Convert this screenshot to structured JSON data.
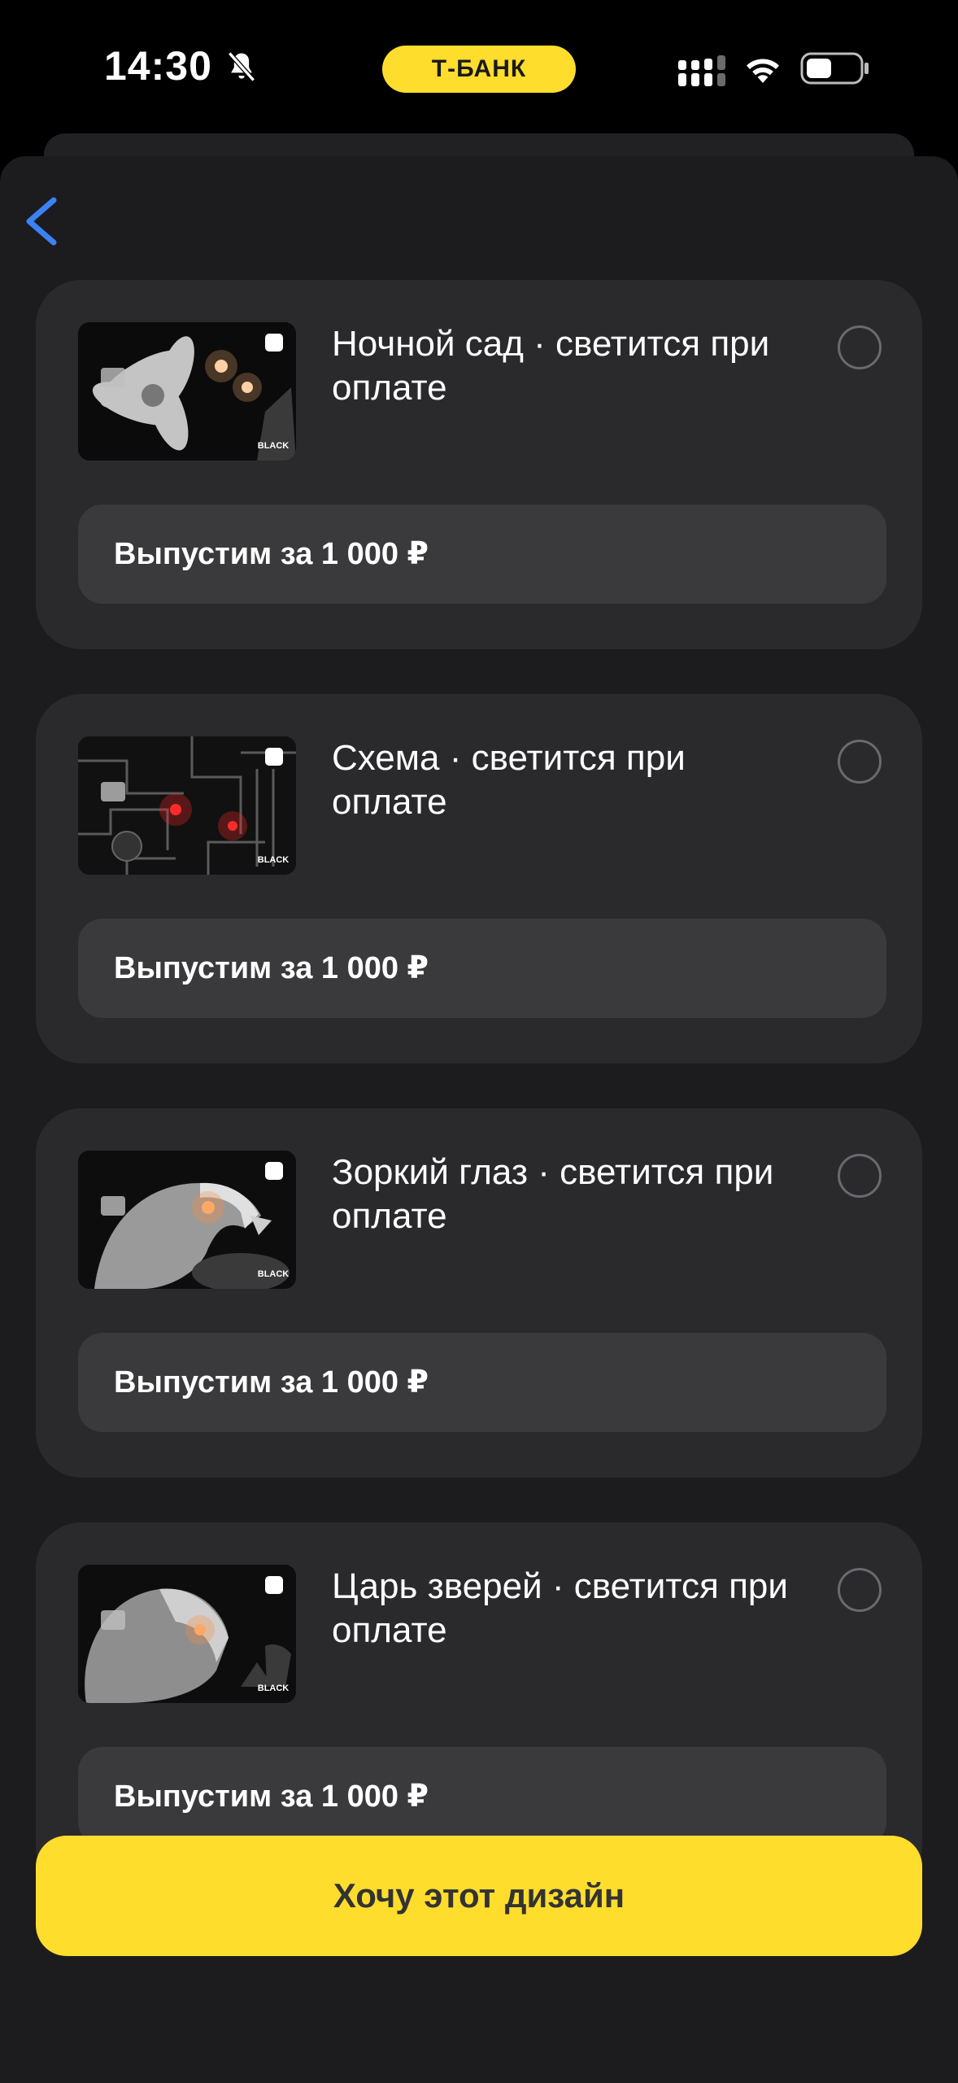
{
  "status_bar": {
    "time": "14:30",
    "carrier": "Т-БАНК",
    "icons": [
      "bell-slash-icon",
      "signal-icon",
      "wifi-icon",
      "battery-icon"
    ]
  },
  "nav": {
    "back_icon": "chevron-left-icon"
  },
  "cards": [
    {
      "title": "Ночной сад · светится при оплате",
      "price": "Выпустим за 1 000 ₽",
      "selected": false,
      "thumb_label": "BLACK",
      "thumb_motif": "flower"
    },
    {
      "title": "Схема · светится при оплате",
      "price": "Выпустим за 1 000 ₽",
      "selected": false,
      "thumb_label": "BLACK",
      "thumb_motif": "circuit"
    },
    {
      "title": "Зоркий глаз · светится при оплате",
      "price": "Выпустим за 1 000 ₽",
      "selected": false,
      "thumb_label": "BLACK",
      "thumb_motif": "eagle"
    },
    {
      "title": "Царь зверей · светится при оплате",
      "price": "Выпустим за 1 000 ₽",
      "selected": false,
      "thumb_label": "BLACK",
      "thumb_motif": "lion"
    }
  ],
  "cta": {
    "label": "Хочу этот дизайн"
  },
  "colors": {
    "accent": "#FFDD2D",
    "card_bg": "#2A2A2D",
    "sheet_bg": "#1C1C1E",
    "back_arrow": "#3B82F6"
  }
}
